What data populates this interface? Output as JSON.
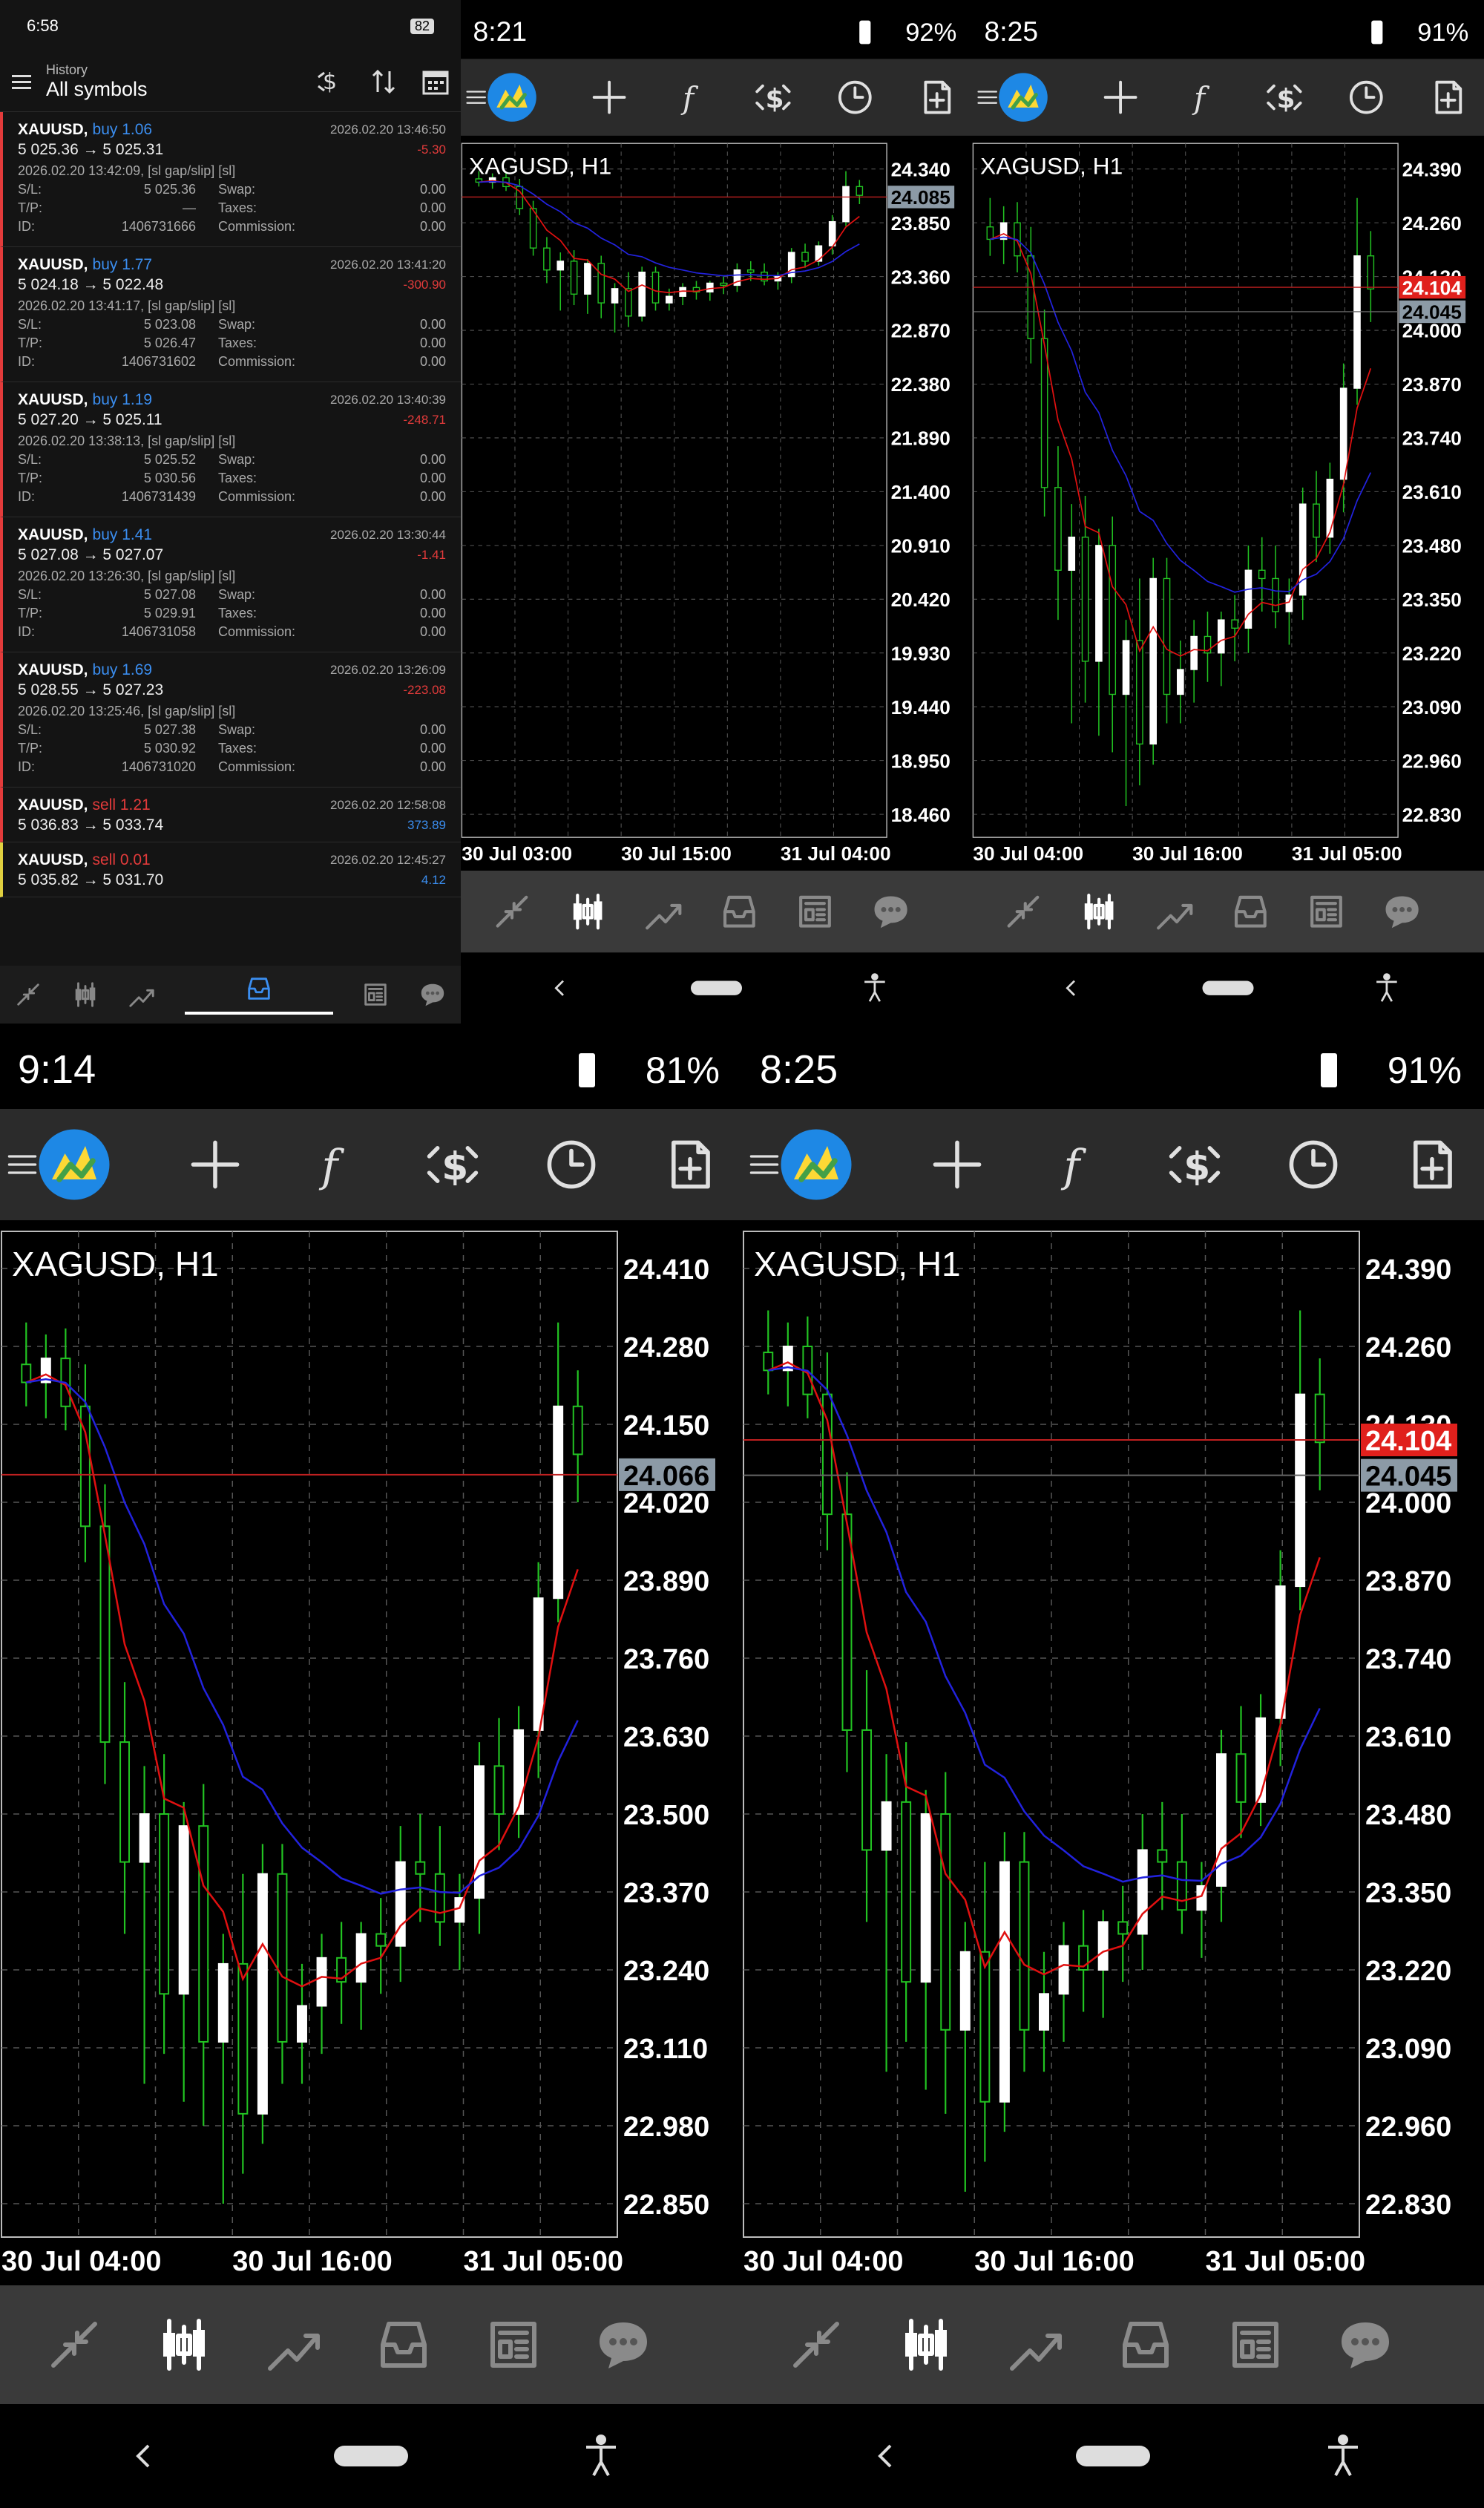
{
  "history": {
    "status_time": "6:58",
    "battery": "82",
    "header_small": "History",
    "header_title": "All symbols",
    "rows": [
      {
        "symbol": "XAUUSD",
        "side": "buy",
        "volume": "1.06",
        "prices": "5 025.36 → 5 025.31",
        "time": "2026.02.20 13:46:50",
        "profit": "-5.30",
        "open_line": "2026.02.20 13:42:09, [sl gap/slip] [sl]",
        "sl": "5 025.36",
        "tp": "—",
        "id": "1406731666",
        "swap": "0.00",
        "taxes": "0.00",
        "commission": "0.00"
      },
      {
        "symbol": "XAUUSD",
        "side": "buy",
        "volume": "1.77",
        "prices": "5 024.18 → 5 022.48",
        "time": "2026.02.20 13:41:20",
        "profit": "-300.90",
        "open_line": "2026.02.20 13:41:17, [sl gap/slip] [sl]",
        "sl": "5 023.08",
        "tp": "5 026.47",
        "id": "1406731602",
        "swap": "0.00",
        "taxes": "0.00",
        "commission": "0.00"
      },
      {
        "symbol": "XAUUSD",
        "side": "buy",
        "volume": "1.19",
        "prices": "5 027.20 → 5 025.11",
        "time": "2026.02.20 13:40:39",
        "profit": "-248.71",
        "open_line": "2026.02.20 13:38:13, [sl gap/slip] [sl]",
        "sl": "5 025.52",
        "tp": "5 030.56",
        "id": "1406731439",
        "swap": "0.00",
        "taxes": "0.00",
        "commission": "0.00"
      },
      {
        "symbol": "XAUUSD",
        "side": "buy",
        "volume": "1.41",
        "prices": "5 027.08 → 5 027.07",
        "time": "2026.02.20 13:30:44",
        "profit": "-1.41",
        "open_line": "2026.02.20 13:26:30, [sl gap/slip] [sl]",
        "sl": "5 027.08",
        "tp": "5 029.91",
        "id": "1406731058",
        "swap": "0.00",
        "taxes": "0.00",
        "commission": "0.00"
      },
      {
        "symbol": "XAUUSD",
        "side": "buy",
        "volume": "1.69",
        "prices": "5 028.55 → 5 027.23",
        "time": "2026.02.20 13:26:09",
        "profit": "-223.08",
        "open_line": "2026.02.20 13:25:46, [sl gap/slip] [sl]",
        "sl": "5 027.38",
        "tp": "5 030.92",
        "id": "1406731020",
        "swap": "0.00",
        "taxes": "0.00",
        "commission": "0.00"
      }
    ],
    "short_rows": [
      {
        "symbol": "XAUUSD",
        "side": "sell",
        "volume": "1.21",
        "prices": "5 036.83 → 5 033.74",
        "time": "2026.02.20 12:58:08",
        "profit": "373.89"
      },
      {
        "symbol": "XAUUSD",
        "side": "sell",
        "volume": "0.01",
        "prices": "5 035.82 → 5 031.70",
        "time": "2026.02.20 12:45:27",
        "profit": "4.12"
      }
    ],
    "labels": {
      "sl": "S/L:",
      "tp": "T/P:",
      "id": "ID:",
      "swap": "Swap:",
      "taxes": "Taxes:",
      "commission": "Commission:"
    }
  },
  "panels": [
    {
      "status_time": "8:21",
      "battery": "92%",
      "symbol": "XAGUSD, H1",
      "price_labels": [
        "24.340",
        "23.850",
        "23.360",
        "22.870",
        "22.380",
        "21.890",
        "21.400",
        "20.910",
        "20.420",
        "19.930",
        "19.440",
        "18.950",
        "18.460"
      ],
      "bid": "24.085",
      "ask": "",
      "time_labels": [
        "30 Jul 03:00",
        "30 Jul 15:00",
        "31 Jul 04:00"
      ],
      "tick_size": "1"
    },
    {
      "status_time": "8:25",
      "battery": "91%",
      "symbol": "XAGUSD, H1",
      "price_labels": [
        "24.390",
        "24.260",
        "24.130",
        "24.000",
        "23.870",
        "23.740",
        "23.610",
        "23.480",
        "23.350",
        "23.220",
        "23.090",
        "22.960",
        "22.830"
      ],
      "bid": "24.104",
      "ask": "24.045",
      "time_labels": [
        "30 Jul 04:00",
        "30 Jul 16:00",
        "31 Jul 05:00"
      ]
    },
    {
      "status_time": "9:14",
      "battery": "81%",
      "symbol": "XAGUSD, H1",
      "price_labels": [
        "24.410",
        "24.280",
        "24.150",
        "24.020",
        "23.890",
        "23.760",
        "23.630",
        "23.500",
        "23.370",
        "23.240",
        "23.110",
        "22.980",
        "22.850"
      ],
      "bid": "24.066",
      "ask": "",
      "time_labels": [
        "30 Jul 04:00",
        "30 Jul 16:00",
        "31 Jul 05:00"
      ]
    },
    {
      "status_time": "8:25",
      "battery": "91%",
      "symbol": "XAGUSD, H1",
      "price_labels": [
        "24.390",
        "24.260",
        "24.130",
        "24.000",
        "23.870",
        "23.740",
        "23.610",
        "23.480",
        "23.350",
        "23.220",
        "23.090",
        "22.960",
        "22.830"
      ],
      "bid": "24.104",
      "ask": "24.045",
      "time_labels": [
        "30 Jul 04:00",
        "30 Jul 16:00",
        "31 Jul 05:00"
      ]
    }
  ],
  "colors": {
    "bull": "#ffffff",
    "bear": "#000000",
    "wick": "#22c322",
    "ma_fast": "#e01010",
    "ma_slow": "#2222dd",
    "loss": "#e33b3b",
    "profit": "#3b8ef0",
    "buy": "#3b8ef0",
    "sell": "#e33b3b"
  },
  "chart_data": {
    "type": "candlestick",
    "symbol": "XAGUSD",
    "timeframe": "H1",
    "candles": [
      {
        "o": 24.25,
        "h": 24.32,
        "l": 24.18,
        "c": 24.22
      },
      {
        "o": 24.22,
        "h": 24.3,
        "l": 24.16,
        "c": 24.26
      },
      {
        "o": 24.26,
        "h": 24.31,
        "l": 24.14,
        "c": 24.18
      },
      {
        "o": 24.18,
        "h": 24.25,
        "l": 23.92,
        "c": 23.98
      },
      {
        "o": 23.98,
        "h": 24.05,
        "l": 23.55,
        "c": 23.62
      },
      {
        "o": 23.62,
        "h": 23.72,
        "l": 23.3,
        "c": 23.42
      },
      {
        "o": 23.42,
        "h": 23.58,
        "l": 23.05,
        "c": 23.5
      },
      {
        "o": 23.5,
        "h": 23.6,
        "l": 23.1,
        "c": 23.2
      },
      {
        "o": 23.2,
        "h": 23.52,
        "l": 23.02,
        "c": 23.48
      },
      {
        "o": 23.48,
        "h": 23.55,
        "l": 22.98,
        "c": 23.12
      },
      {
        "o": 23.12,
        "h": 23.3,
        "l": 22.85,
        "c": 23.25
      },
      {
        "o": 23.25,
        "h": 23.4,
        "l": 22.9,
        "c": 23.0
      },
      {
        "o": 23.0,
        "h": 23.45,
        "l": 22.95,
        "c": 23.4
      },
      {
        "o": 23.4,
        "h": 23.45,
        "l": 23.05,
        "c": 23.12
      },
      {
        "o": 23.12,
        "h": 23.25,
        "l": 23.05,
        "c": 23.18
      },
      {
        "o": 23.18,
        "h": 23.3,
        "l": 23.1,
        "c": 23.26
      },
      {
        "o": 23.26,
        "h": 23.32,
        "l": 23.15,
        "c": 23.22
      },
      {
        "o": 23.22,
        "h": 23.32,
        "l": 23.14,
        "c": 23.3
      },
      {
        "o": 23.3,
        "h": 23.36,
        "l": 23.2,
        "c": 23.28
      },
      {
        "o": 23.28,
        "h": 23.48,
        "l": 23.22,
        "c": 23.42
      },
      {
        "o": 23.42,
        "h": 23.5,
        "l": 23.32,
        "c": 23.4
      },
      {
        "o": 23.4,
        "h": 23.48,
        "l": 23.28,
        "c": 23.32
      },
      {
        "o": 23.32,
        "h": 23.4,
        "l": 23.24,
        "c": 23.36
      },
      {
        "o": 23.36,
        "h": 23.62,
        "l": 23.3,
        "c": 23.58
      },
      {
        "o": 23.58,
        "h": 23.66,
        "l": 23.44,
        "c": 23.5
      },
      {
        "o": 23.5,
        "h": 23.68,
        "l": 23.46,
        "c": 23.64
      },
      {
        "o": 23.64,
        "h": 23.92,
        "l": 23.56,
        "c": 23.86
      },
      {
        "o": 23.86,
        "h": 24.32,
        "l": 23.82,
        "c": 24.18
      },
      {
        "o": 24.18,
        "h": 24.24,
        "l": 24.02,
        "c": 24.1
      }
    ]
  },
  "toolbar_icons": [
    "menu-icon",
    "mt-logo-icon",
    "crosshair-icon",
    "indicators-icon",
    "trade-icon",
    "timeframe-icon",
    "new-order-icon"
  ],
  "bottom_icons": [
    "quotes-icon",
    "chart-icon",
    "trade-tab-icon",
    "history-icon",
    "news-icon",
    "messages-icon"
  ]
}
